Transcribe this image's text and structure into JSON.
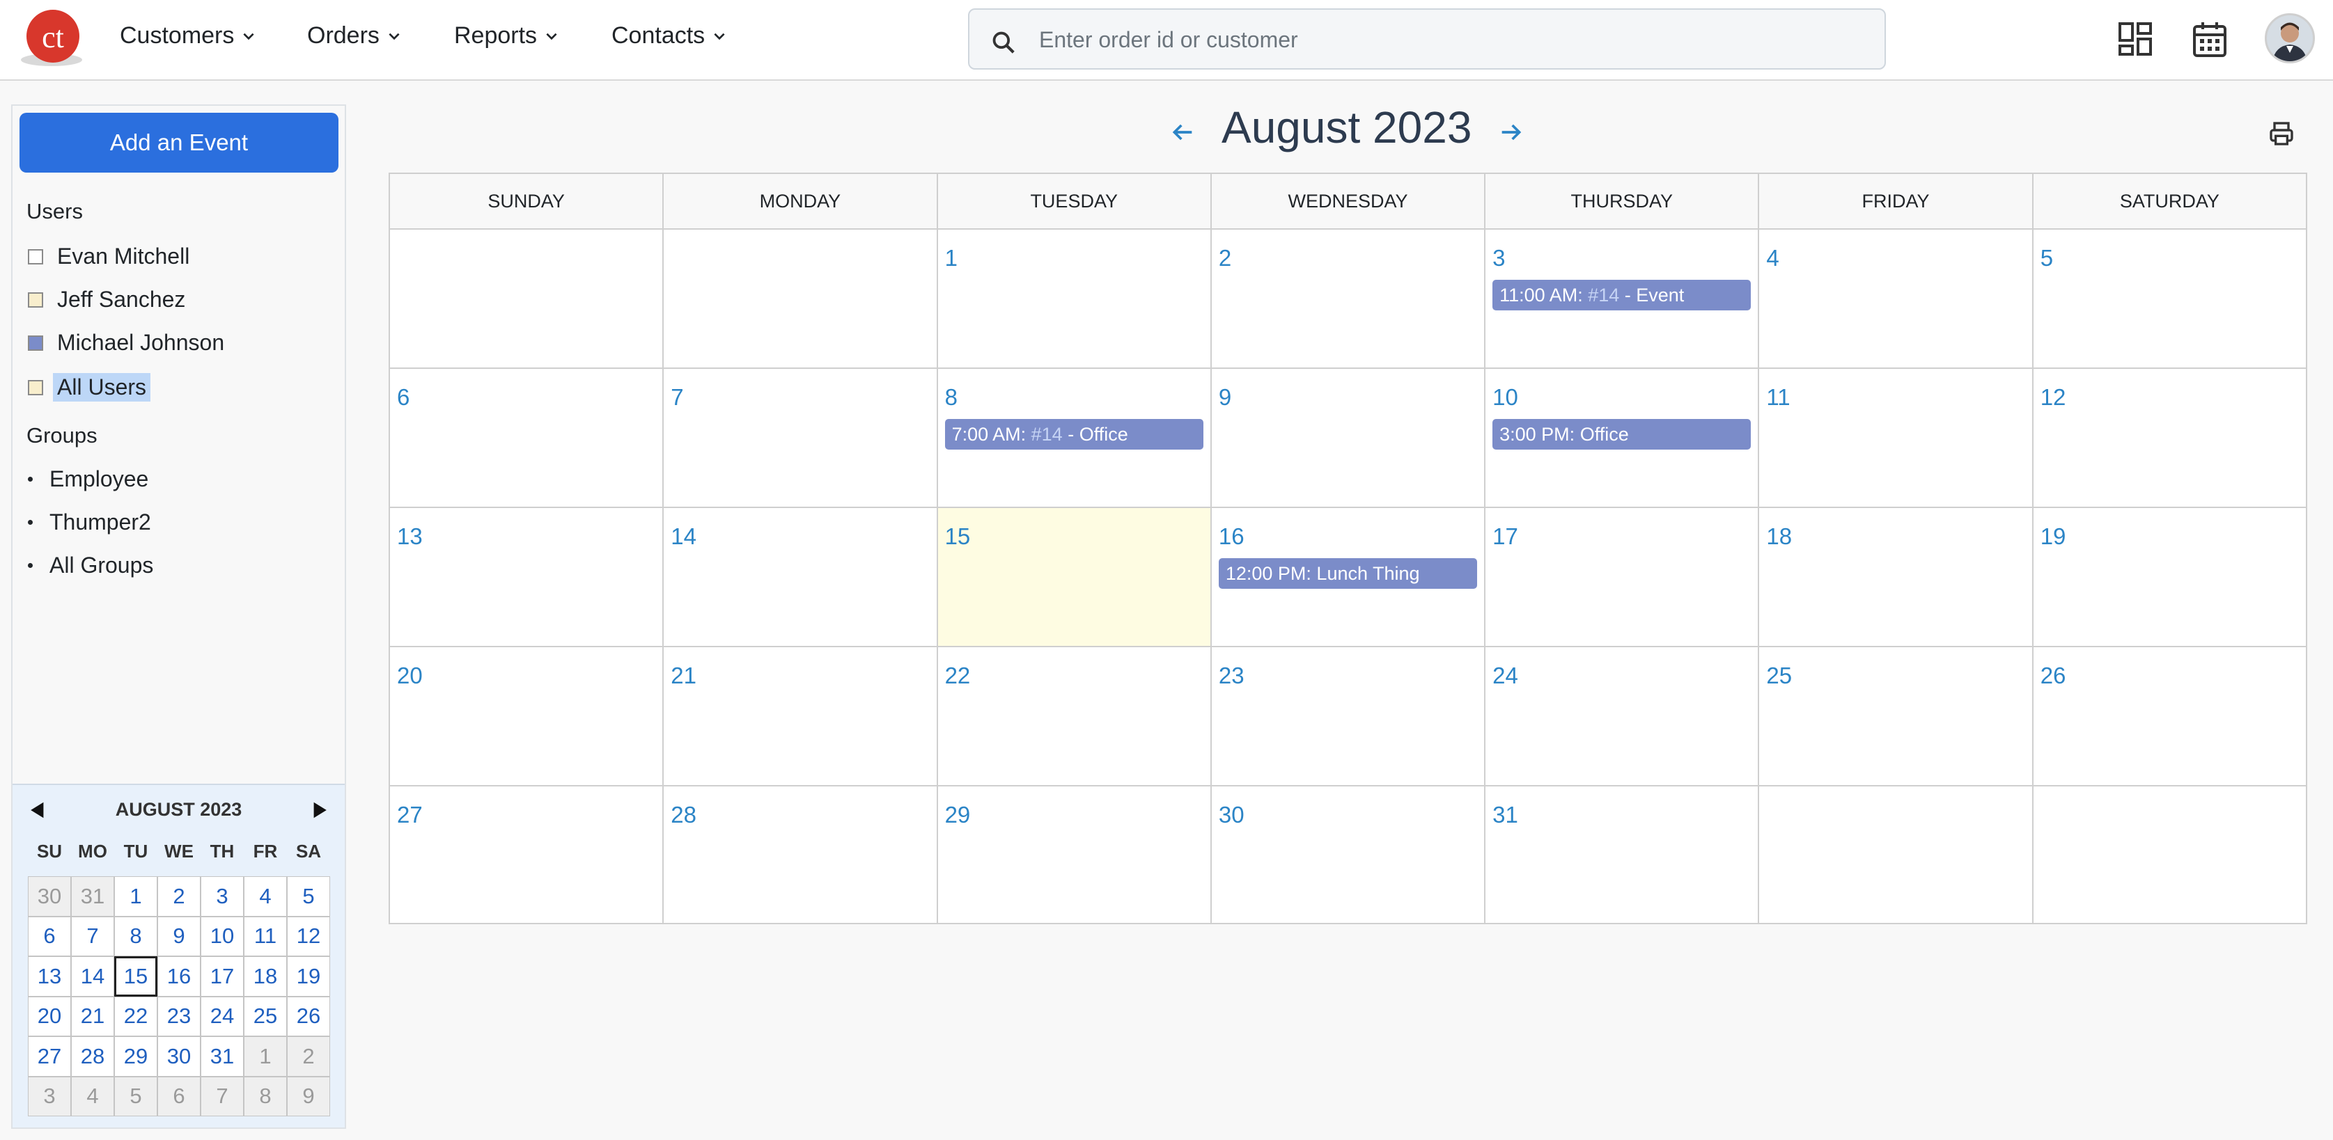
{
  "nav": {
    "items": [
      {
        "label": "Customers"
      },
      {
        "label": "Orders"
      },
      {
        "label": "Reports"
      },
      {
        "label": "Contacts"
      }
    ],
    "search_placeholder": "Enter order id or customer",
    "icons": [
      "dashboard-icon",
      "calendar-icon",
      "avatar"
    ]
  },
  "sidebar": {
    "add_event": "Add an Event",
    "users_title": "Users",
    "users": [
      {
        "name": "Evan Mitchell",
        "color": "#ffffff"
      },
      {
        "name": "Jeff Sanchez",
        "color": "#f8eecd"
      },
      {
        "name": "Michael Johnson",
        "color": "#7b8cc9"
      },
      {
        "name": "All Users",
        "color": "#f8eecd",
        "selected": true
      }
    ],
    "groups_title": "Groups",
    "groups": [
      "Employee",
      "Thumper2",
      "All Groups"
    ]
  },
  "mini_calendar": {
    "title": "AUGUST 2023",
    "dows": [
      "SU",
      "MO",
      "TU",
      "WE",
      "TH",
      "FR",
      "SA"
    ],
    "cells": [
      {
        "d": "30",
        "out": true
      },
      {
        "d": "31",
        "out": true
      },
      {
        "d": "1"
      },
      {
        "d": "2"
      },
      {
        "d": "3"
      },
      {
        "d": "4"
      },
      {
        "d": "5"
      },
      {
        "d": "6"
      },
      {
        "d": "7"
      },
      {
        "d": "8"
      },
      {
        "d": "9"
      },
      {
        "d": "10"
      },
      {
        "d": "11"
      },
      {
        "d": "12"
      },
      {
        "d": "13"
      },
      {
        "d": "14"
      },
      {
        "d": "15",
        "today": true
      },
      {
        "d": "16"
      },
      {
        "d": "17"
      },
      {
        "d": "18"
      },
      {
        "d": "19"
      },
      {
        "d": "20"
      },
      {
        "d": "21"
      },
      {
        "d": "22"
      },
      {
        "d": "23"
      },
      {
        "d": "24"
      },
      {
        "d": "25"
      },
      {
        "d": "26"
      },
      {
        "d": "27"
      },
      {
        "d": "28"
      },
      {
        "d": "29"
      },
      {
        "d": "30"
      },
      {
        "d": "31"
      },
      {
        "d": "1",
        "out": true
      },
      {
        "d": "2",
        "out": true
      },
      {
        "d": "3",
        "out": true
      },
      {
        "d": "4",
        "out": true
      },
      {
        "d": "5",
        "out": true
      },
      {
        "d": "6",
        "out": true
      },
      {
        "d": "7",
        "out": true
      },
      {
        "d": "8",
        "out": true
      },
      {
        "d": "9",
        "out": true
      }
    ]
  },
  "calendar": {
    "title": "August 2023",
    "dows": [
      "SUNDAY",
      "MONDAY",
      "TUESDAY",
      "WEDNESDAY",
      "THURSDAY",
      "FRIDAY",
      "SATURDAY"
    ],
    "weeks": [
      [
        {
          "d": ""
        },
        {
          "d": ""
        },
        {
          "d": "1"
        },
        {
          "d": "2"
        },
        {
          "d": "3",
          "event": {
            "time": "11:00 AM: ",
            "tag": "#14",
            "text": " - Event"
          }
        },
        {
          "d": "4"
        },
        {
          "d": "5"
        }
      ],
      [
        {
          "d": "6"
        },
        {
          "d": "7"
        },
        {
          "d": "8",
          "event": {
            "time": "7:00 AM: ",
            "tag": "#14",
            "text": " - Office"
          }
        },
        {
          "d": "9"
        },
        {
          "d": "10",
          "event": {
            "time": "3:00 PM: ",
            "tag": "",
            "text": "Office"
          }
        },
        {
          "d": "11"
        },
        {
          "d": "12"
        }
      ],
      [
        {
          "d": "13"
        },
        {
          "d": "14"
        },
        {
          "d": "15",
          "today": true
        },
        {
          "d": "16",
          "event": {
            "time": "12:00 PM: ",
            "tag": "",
            "text": "Lunch Thing"
          }
        },
        {
          "d": "17"
        },
        {
          "d": "18"
        },
        {
          "d": "19"
        }
      ],
      [
        {
          "d": "20"
        },
        {
          "d": "21"
        },
        {
          "d": "22"
        },
        {
          "d": "23"
        },
        {
          "d": "24"
        },
        {
          "d": "25"
        },
        {
          "d": "26"
        }
      ],
      [
        {
          "d": "27"
        },
        {
          "d": "28"
        },
        {
          "d": "29"
        },
        {
          "d": "30"
        },
        {
          "d": "31"
        },
        {
          "d": ""
        },
        {
          "d": ""
        }
      ]
    ]
  },
  "colors": {
    "accent": "#2b6fde",
    "event": "#7b8cc9",
    "today": "#fefce2",
    "day_number": "#2b84c6"
  }
}
